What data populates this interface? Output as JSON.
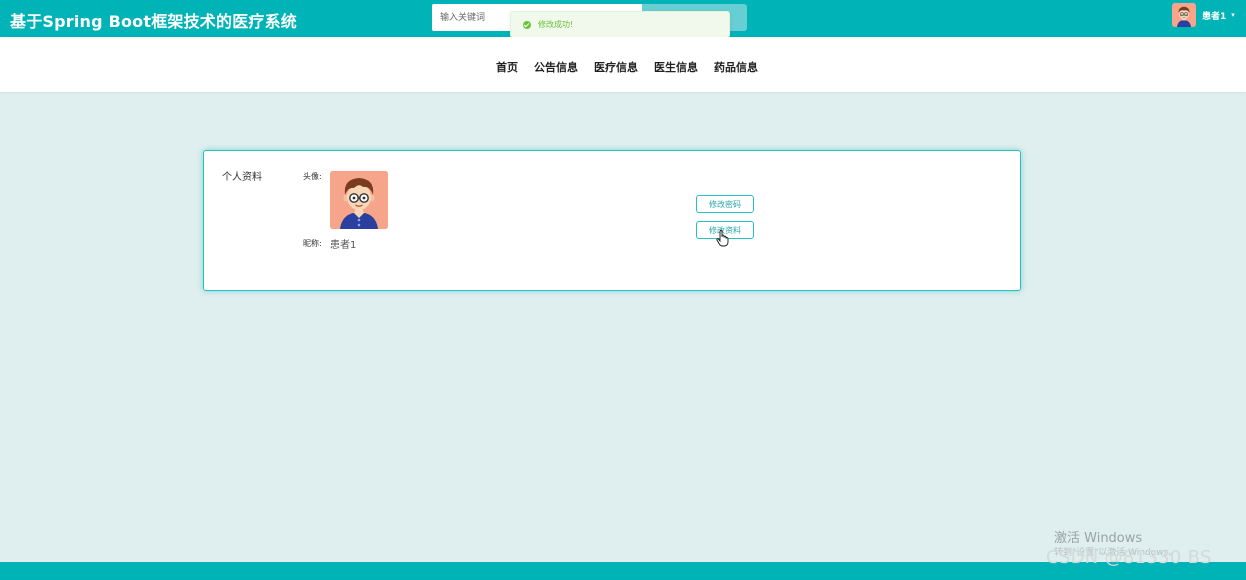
{
  "header": {
    "title": "基于Spring Boot框架技术的医疗系统",
    "search_placeholder": "输入关键词",
    "user_name": "患者1"
  },
  "toast": {
    "message": "修改成功!"
  },
  "nav": {
    "items": [
      "首页",
      "公告信息",
      "医疗信息",
      "医生信息",
      "药品信息"
    ]
  },
  "profile": {
    "section_title": "个人资料",
    "avatar_label": "头像:",
    "nickname_label": "昵称:",
    "nickname_value": "患者1",
    "change_password_label": "修改密码",
    "edit_profile_label": "修改资料"
  },
  "os_overlay": {
    "activate_title": "激活 Windows",
    "activate_sub": "转到\"设置\"以激活 Windows。",
    "watermark": "CSDN @81330 BS"
  },
  "colors": {
    "primary": "#00b3b6",
    "page_bg": "#dfeeee",
    "success": "#67c23a"
  }
}
